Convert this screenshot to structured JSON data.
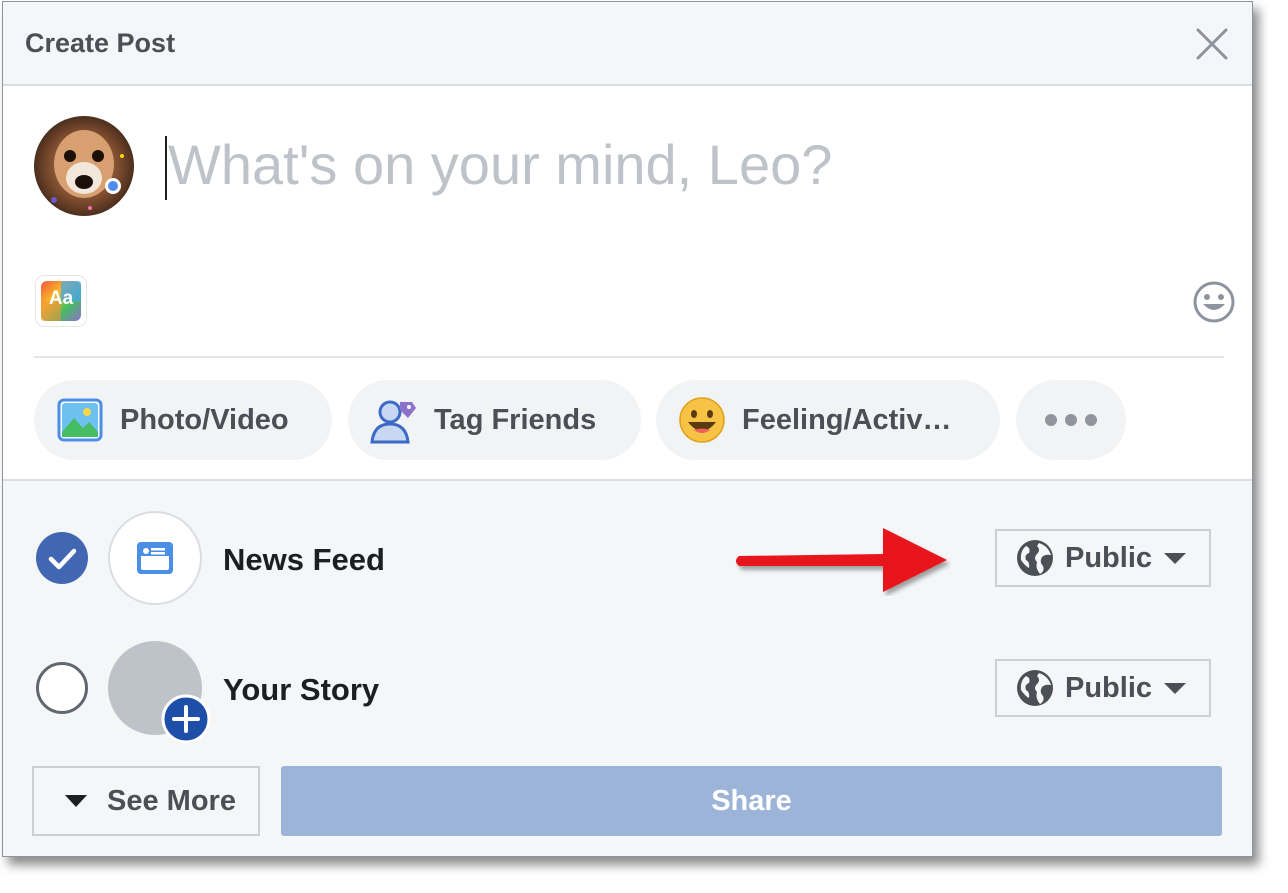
{
  "dialog": {
    "title": "Create Post",
    "close_icon": "close-icon"
  },
  "composer": {
    "placeholder": "What's on your mind, Leo?",
    "text_format_label": "Aa"
  },
  "actions": [
    {
      "label": "Photo/Video",
      "icon": "photo-video-icon"
    },
    {
      "label": "Tag Friends",
      "icon": "tag-friends-icon"
    },
    {
      "label": "Feeling/Activ…",
      "icon": "feeling-emoji-icon"
    },
    {
      "label": "",
      "icon": "more-dots-icon"
    }
  ],
  "destinations": [
    {
      "label": "News Feed",
      "checked": true,
      "privacy": "Public"
    },
    {
      "label": "Your Story",
      "checked": false,
      "privacy": "Public"
    }
  ],
  "footer": {
    "see_more_label": "See More",
    "share_label": "Share"
  },
  "colors": {
    "accent": "#4267b2",
    "share_disabled": "#9cb4d8",
    "annotation_arrow": "#e8141a"
  }
}
